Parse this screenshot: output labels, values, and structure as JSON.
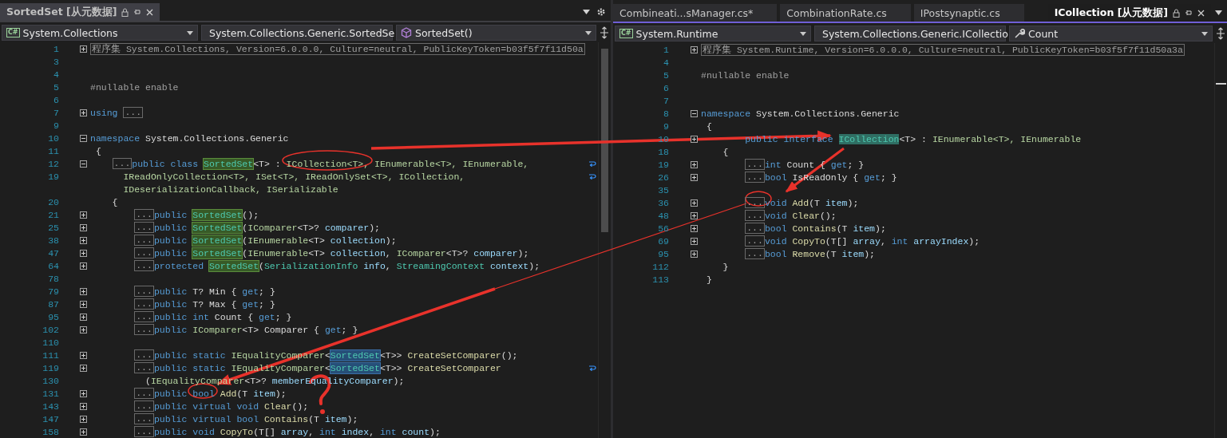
{
  "panes": [
    {
      "tabs": [
        {
          "label": "SortedSet [从元数据]",
          "selected": false,
          "locked": true
        }
      ],
      "nav": [
        {
          "kind": "project",
          "badge": "C#",
          "text": "System.Collections"
        },
        {
          "kind": "class",
          "text": "System.Collections.Generic.SortedSe"
        },
        {
          "kind": "method",
          "text": "SortedSet()"
        }
      ],
      "lines": [
        {
          "number": "1",
          "expanded": false,
          "kind": "region",
          "text": "程序集 System.Collections, Version=6.0.0.0, Culture=neutral, PublicKeyToken=b03f5f7f11d50a"
        },
        {
          "number": "3"
        },
        {
          "number": "4"
        },
        {
          "number": "5",
          "kind": "top",
          "tokens": [
            {
              "kind": "directive",
              "text": "#nullable enable"
            }
          ]
        },
        {
          "number": "6"
        },
        {
          "number": "7",
          "expanded": false,
          "kind": "top",
          "tokens": [
            {
              "kind": "kw",
              "text": "using "
            },
            {
              "kind": "collapsed",
              "text": "..."
            }
          ]
        },
        {
          "number": "9"
        },
        {
          "number": "10",
          "expanded": true,
          "kind": "top",
          "tokens": [
            {
              "kind": "kw",
              "text": "namespace"
            },
            {
              "kind": "plain",
              "text": " System.Collections.Generic"
            }
          ]
        },
        {
          "number": "11",
          "kind": "top",
          "tokens": [
            {
              "kind": "plain",
              "text": " {"
            }
          ]
        },
        {
          "number": "12",
          "expanded": true,
          "wrapped": true,
          "kind": "type",
          "tokens": [
            {
              "kind": "collapsed",
              "text": "..."
            },
            {
              "kind": "kw",
              "text": "public class "
            },
            {
              "kind": "hl-def",
              "text": "SortedSet"
            },
            {
              "kind": "plain",
              "text": "<T> : "
            },
            {
              "kind": "iface",
              "text": "ICollection<T>, IEnumerable<T>, IEnumerable,"
            }
          ]
        },
        {
          "number": "19",
          "wrapped": true,
          "kind": "type-cont",
          "tokens": [
            {
              "kind": "iface",
              "text": "IReadOnlyCollection<T>, ISet<T>, IReadOnlySet<T>, ICollection,"
            }
          ]
        },
        {
          "kind": "type-cont",
          "tokens": [
            {
              "kind": "iface",
              "text": "IDeserializationCallback, ISerializable"
            }
          ]
        },
        {
          "number": "20",
          "kind": "type",
          "tokens": [
            {
              "kind": "plain",
              "text": "{"
            }
          ]
        },
        {
          "number": "21",
          "expanded": false,
          "kind": "member",
          "tokens": [
            {
              "kind": "collapsed",
              "text": "..."
            },
            {
              "kind": "kw",
              "text": "public "
            },
            {
              "kind": "hl-def",
              "text": "SortedSet"
            },
            {
              "kind": "plain",
              "text": "();"
            }
          ]
        },
        {
          "number": "25",
          "expanded": false,
          "kind": "member",
          "tokens": [
            {
              "kind": "collapsed",
              "text": "..."
            },
            {
              "kind": "kw",
              "text": "public "
            },
            {
              "kind": "hl-def",
              "text": "SortedSet"
            },
            {
              "kind": "plain",
              "text": "("
            },
            {
              "kind": "iface",
              "text": "IComparer"
            },
            {
              "kind": "plain",
              "text": "<T>? "
            },
            {
              "kind": "param",
              "text": "comparer"
            },
            {
              "kind": "plain",
              "text": ");"
            }
          ]
        },
        {
          "number": "38",
          "expanded": false,
          "kind": "member",
          "tokens": [
            {
              "kind": "collapsed",
              "text": "..."
            },
            {
              "kind": "kw",
              "text": "public "
            },
            {
              "kind": "hl-def",
              "text": "SortedSet"
            },
            {
              "kind": "plain",
              "text": "("
            },
            {
              "kind": "iface",
              "text": "IEnumerable"
            },
            {
              "kind": "plain",
              "text": "<T> "
            },
            {
              "kind": "param",
              "text": "collection"
            },
            {
              "kind": "plain",
              "text": ");"
            }
          ]
        },
        {
          "number": "47",
          "expanded": false,
          "kind": "member",
          "tokens": [
            {
              "kind": "collapsed",
              "text": "..."
            },
            {
              "kind": "kw",
              "text": "public "
            },
            {
              "kind": "hl-def",
              "text": "SortedSet"
            },
            {
              "kind": "plain",
              "text": "("
            },
            {
              "kind": "iface",
              "text": "IEnumerable"
            },
            {
              "kind": "plain",
              "text": "<T> "
            },
            {
              "kind": "param",
              "text": "collection"
            },
            {
              "kind": "plain",
              "text": ", "
            },
            {
              "kind": "iface",
              "text": "IComparer"
            },
            {
              "kind": "plain",
              "text": "<T>? "
            },
            {
              "kind": "param",
              "text": "comparer"
            },
            {
              "kind": "plain",
              "text": ");"
            }
          ]
        },
        {
          "number": "64",
          "expanded": false,
          "kind": "member",
          "tokens": [
            {
              "kind": "collapsed",
              "text": "..."
            },
            {
              "kind": "kw",
              "text": "protected "
            },
            {
              "kind": "hl-def",
              "text": "SortedSet"
            },
            {
              "kind": "plain",
              "text": "("
            },
            {
              "kind": "type",
              "text": "SerializationInfo"
            },
            {
              "kind": "param",
              "text": " info"
            },
            {
              "kind": "plain",
              "text": ", "
            },
            {
              "kind": "type",
              "text": "StreamingContext"
            },
            {
              "kind": "param",
              "text": " context"
            },
            {
              "kind": "plain",
              "text": ");"
            }
          ]
        },
        {
          "number": "78"
        },
        {
          "number": "79",
          "expanded": false,
          "kind": "member",
          "tokens": [
            {
              "kind": "collapsed",
              "text": "..."
            },
            {
              "kind": "kw",
              "text": "public "
            },
            {
              "kind": "plain",
              "text": "T? Min { "
            },
            {
              "kind": "kw",
              "text": "get"
            },
            {
              "kind": "plain",
              "text": "; }"
            }
          ]
        },
        {
          "number": "87",
          "expanded": false,
          "kind": "member",
          "tokens": [
            {
              "kind": "collapsed",
              "text": "..."
            },
            {
              "kind": "kw",
              "text": "public "
            },
            {
              "kind": "plain",
              "text": "T? Max { "
            },
            {
              "kind": "kw",
              "text": "get"
            },
            {
              "kind": "plain",
              "text": "; }"
            }
          ]
        },
        {
          "number": "95",
          "expanded": false,
          "kind": "member",
          "tokens": [
            {
              "kind": "collapsed",
              "text": "..."
            },
            {
              "kind": "kw",
              "text": "public int "
            },
            {
              "kind": "plain",
              "text": "Count { "
            },
            {
              "kind": "kw",
              "text": "get"
            },
            {
              "kind": "plain",
              "text": "; }"
            }
          ]
        },
        {
          "number": "102",
          "expanded": false,
          "kind": "member",
          "tokens": [
            {
              "kind": "collapsed",
              "text": "..."
            },
            {
              "kind": "kw",
              "text": "public "
            },
            {
              "kind": "iface",
              "text": "IComparer"
            },
            {
              "kind": "plain",
              "text": "<T> Comparer { "
            },
            {
              "kind": "kw",
              "text": "get"
            },
            {
              "kind": "plain",
              "text": "; }"
            }
          ]
        },
        {
          "number": "110"
        },
        {
          "number": "111",
          "expanded": false,
          "kind": "member",
          "tokens": [
            {
              "kind": "collapsed",
              "text": "..."
            },
            {
              "kind": "kw",
              "text": "public static "
            },
            {
              "kind": "iface",
              "text": "IEqualityComparer"
            },
            {
              "kind": "plain",
              "text": "<"
            },
            {
              "kind": "hl-ref",
              "text": "SortedSet"
            },
            {
              "kind": "plain",
              "text": "<T>> "
            },
            {
              "kind": "method",
              "text": "CreateSetComparer"
            },
            {
              "kind": "plain",
              "text": "();"
            }
          ]
        },
        {
          "number": "119",
          "expanded": false,
          "wrapped": true,
          "kind": "member",
          "tokens": [
            {
              "kind": "collapsed",
              "text": "..."
            },
            {
              "kind": "kw",
              "text": "public static "
            },
            {
              "kind": "iface",
              "text": "IEqualityComparer"
            },
            {
              "kind": "plain",
              "text": "<"
            },
            {
              "kind": "hl-ref",
              "text": "SortedSet"
            },
            {
              "kind": "plain",
              "text": "<T>> "
            },
            {
              "kind": "method",
              "text": "CreateSetComparer"
            }
          ]
        },
        {
          "number": "130",
          "kind": "member-cont",
          "tokens": [
            {
              "kind": "plain",
              "text": "("
            },
            {
              "kind": "iface",
              "text": "IEqualityComparer"
            },
            {
              "kind": "plain",
              "text": "<T>? "
            },
            {
              "kind": "param",
              "text": "memberEqualityComparer"
            },
            {
              "kind": "plain",
              "text": ");"
            }
          ]
        },
        {
          "number": "131",
          "expanded": false,
          "kind": "member",
          "tokens": [
            {
              "kind": "collapsed",
              "text": "..."
            },
            {
              "kind": "kw",
              "text": "public bool "
            },
            {
              "kind": "method",
              "text": "Add"
            },
            {
              "kind": "plain",
              "text": "(T "
            },
            {
              "kind": "param",
              "text": "item"
            },
            {
              "kind": "plain",
              "text": ");"
            }
          ]
        },
        {
          "number": "143",
          "expanded": false,
          "kind": "member",
          "tokens": [
            {
              "kind": "collapsed",
              "text": "..."
            },
            {
              "kind": "kw",
              "text": "public virtual void "
            },
            {
              "kind": "method",
              "text": "Clear"
            },
            {
              "kind": "plain",
              "text": "();"
            }
          ]
        },
        {
          "number": "147",
          "expanded": false,
          "kind": "member",
          "tokens": [
            {
              "kind": "collapsed",
              "text": "..."
            },
            {
              "kind": "kw",
              "text": "public virtual bool "
            },
            {
              "kind": "method",
              "text": "Contains"
            },
            {
              "kind": "plain",
              "text": "(T "
            },
            {
              "kind": "param",
              "text": "item"
            },
            {
              "kind": "plain",
              "text": ");"
            }
          ]
        },
        {
          "number": "158",
          "expanded": false,
          "kind": "member",
          "tokens": [
            {
              "kind": "collapsed",
              "text": "..."
            },
            {
              "kind": "kw",
              "text": "public void "
            },
            {
              "kind": "method",
              "text": "CopyTo"
            },
            {
              "kind": "plain",
              "text": "(T[] "
            },
            {
              "kind": "param",
              "text": "array"
            },
            {
              "kind": "plain",
              "text": ", "
            },
            {
              "kind": "kw",
              "text": "int "
            },
            {
              "kind": "param",
              "text": "index"
            },
            {
              "kind": "plain",
              "text": ", "
            },
            {
              "kind": "kw",
              "text": "int "
            },
            {
              "kind": "param",
              "text": "count"
            },
            {
              "kind": "plain",
              "text": ");"
            }
          ]
        }
      ]
    },
    {
      "tabs": [
        {
          "label": "Combineati...sManager.cs*",
          "selected": false,
          "locked": false
        },
        {
          "label": "CombinationRate.cs",
          "selected": false,
          "locked": false
        },
        {
          "label": "IPostsynaptic.cs",
          "selected": false,
          "locked": false
        },
        {
          "label": "ICollection [从元数据]",
          "selected": true,
          "locked": true
        }
      ],
      "nav": [
        {
          "kind": "project",
          "badge": "C#",
          "text": "System.Runtime"
        },
        {
          "kind": "interface",
          "text": "System.Collections.Generic.ICollectio"
        },
        {
          "kind": "property",
          "text": "Count"
        }
      ],
      "lines": [
        {
          "number": "1",
          "expanded": false,
          "kind": "region",
          "text": "程序集 System.Runtime, Version=6.0.0.0, Culture=neutral, PublicKeyToken=b03f5f7f11d50a3a"
        },
        {
          "number": "4"
        },
        {
          "number": "5",
          "kind": "top",
          "tokens": [
            {
              "kind": "directive",
              "text": "#nullable enable"
            }
          ]
        },
        {
          "number": "6"
        },
        {
          "number": "7"
        },
        {
          "number": "8",
          "expanded": true,
          "kind": "top",
          "tokens": [
            {
              "kind": "kw",
              "text": "namespace"
            },
            {
              "kind": "plain",
              "text": " System.Collections.Generic"
            }
          ]
        },
        {
          "number": "9",
          "kind": "top",
          "tokens": [
            {
              "kind": "plain",
              "text": " {"
            }
          ]
        },
        {
          "number": "10",
          "expanded": false,
          "kind": "member",
          "tokens": [
            {
              "kind": "kw",
              "text": "public interface "
            },
            {
              "kind": "hl-focus",
              "text": "ICollection"
            },
            {
              "kind": "plain",
              "text": "<T> : "
            },
            {
              "kind": "iface",
              "text": "IEnumerable<T>, IEnumerable"
            }
          ]
        },
        {
          "number": "18",
          "kind": "type",
          "tokens": [
            {
              "kind": "plain",
              "text": "{"
            }
          ]
        },
        {
          "number": "19",
          "expanded": false,
          "kind": "member",
          "tokens": [
            {
              "kind": "collapsed",
              "text": "..."
            },
            {
              "kind": "kw",
              "text": "int "
            },
            {
              "kind": "plain",
              "text": "Count { "
            },
            {
              "kind": "kw",
              "text": "get"
            },
            {
              "kind": "plain",
              "text": "; }"
            }
          ]
        },
        {
          "number": "26",
          "expanded": false,
          "kind": "member",
          "tokens": [
            {
              "kind": "collapsed",
              "text": "..."
            },
            {
              "kind": "kw",
              "text": "bool "
            },
            {
              "kind": "plain",
              "text": "IsReadOnly { "
            },
            {
              "kind": "kw",
              "text": "get"
            },
            {
              "kind": "plain",
              "text": "; }"
            }
          ]
        },
        {
          "number": "35"
        },
        {
          "number": "36",
          "expanded": false,
          "kind": "member",
          "tokens": [
            {
              "kind": "collapsed",
              "text": "..."
            },
            {
              "kind": "kw",
              "text": "void "
            },
            {
              "kind": "method",
              "text": "Add"
            },
            {
              "kind": "plain",
              "text": "(T "
            },
            {
              "kind": "param",
              "text": "item"
            },
            {
              "kind": "plain",
              "text": ");"
            }
          ]
        },
        {
          "number": "48",
          "expanded": false,
          "kind": "member",
          "tokens": [
            {
              "kind": "collapsed",
              "text": "..."
            },
            {
              "kind": "kw",
              "text": "void "
            },
            {
              "kind": "method",
              "text": "Clear"
            },
            {
              "kind": "plain",
              "text": "();"
            }
          ]
        },
        {
          "number": "56",
          "expanded": false,
          "kind": "member",
          "tokens": [
            {
              "kind": "collapsed",
              "text": "..."
            },
            {
              "kind": "kw",
              "text": "bool "
            },
            {
              "kind": "method",
              "text": "Contains"
            },
            {
              "kind": "plain",
              "text": "(T "
            },
            {
              "kind": "param",
              "text": "item"
            },
            {
              "kind": "plain",
              "text": ");"
            }
          ]
        },
        {
          "number": "69",
          "expanded": false,
          "kind": "member",
          "tokens": [
            {
              "kind": "collapsed",
              "text": "..."
            },
            {
              "kind": "kw",
              "text": "void "
            },
            {
              "kind": "method",
              "text": "CopyTo"
            },
            {
              "kind": "plain",
              "text": "(T[] "
            },
            {
              "kind": "param",
              "text": "array"
            },
            {
              "kind": "plain",
              "text": ", "
            },
            {
              "kind": "kw",
              "text": "int "
            },
            {
              "kind": "param",
              "text": "arrayIndex"
            },
            {
              "kind": "plain",
              "text": ");"
            }
          ]
        },
        {
          "number": "95",
          "expanded": false,
          "kind": "member",
          "tokens": [
            {
              "kind": "collapsed",
              "text": "..."
            },
            {
              "kind": "kw",
              "text": "bool "
            },
            {
              "kind": "method",
              "text": "Remove"
            },
            {
              "kind": "plain",
              "text": "(T "
            },
            {
              "kind": "param",
              "text": "item"
            },
            {
              "kind": "plain",
              "text": ");"
            }
          ]
        },
        {
          "number": "112",
          "kind": "type",
          "tokens": [
            {
              "kind": "plain",
              "text": "}"
            }
          ]
        },
        {
          "number": "113",
          "kind": "top",
          "tokens": [
            {
              "kind": "plain",
              "text": " }"
            }
          ]
        }
      ]
    }
  ]
}
